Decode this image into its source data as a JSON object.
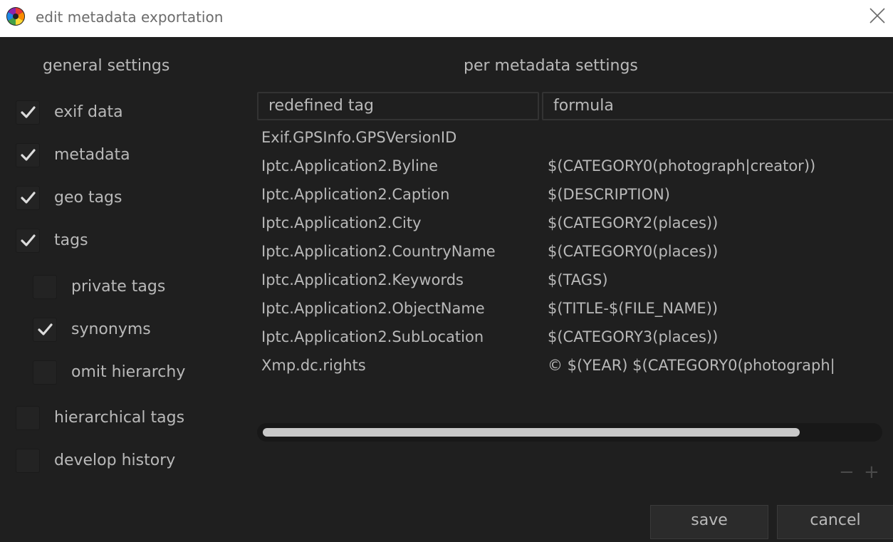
{
  "window": {
    "title": "edit metadata exportation",
    "icon": "darktable-logo-icon",
    "close_icon": "close-icon"
  },
  "general": {
    "header": "general settings",
    "items": [
      {
        "label": "exif data",
        "checked": true
      },
      {
        "label": "metadata",
        "checked": true
      },
      {
        "label": "geo tags",
        "checked": true
      },
      {
        "label": "tags",
        "checked": true
      },
      {
        "label": "private tags",
        "checked": false
      },
      {
        "label": "synonyms",
        "checked": true
      },
      {
        "label": "omit hierarchy",
        "checked": false
      },
      {
        "label": "hierarchical tags",
        "checked": false
      },
      {
        "label": "develop history",
        "checked": false
      }
    ]
  },
  "per_metadata": {
    "header": "per metadata settings",
    "columns": [
      "redefined tag",
      "formula"
    ],
    "rows": [
      {
        "tag": "Exif.GPSInfo.GPSVersionID",
        "formula": ""
      },
      {
        "tag": "Iptc.Application2.Byline",
        "formula": "$(CATEGORY0(photograph|creator))"
      },
      {
        "tag": "Iptc.Application2.Caption",
        "formula": "$(DESCRIPTION)"
      },
      {
        "tag": "Iptc.Application2.City",
        "formula": "$(CATEGORY2(places))"
      },
      {
        "tag": "Iptc.Application2.CountryName",
        "formula": "$(CATEGORY0(places))"
      },
      {
        "tag": "Iptc.Application2.Keywords",
        "formula": "$(TAGS)"
      },
      {
        "tag": "Iptc.Application2.ObjectName",
        "formula": "$(TITLE-$(FILE_NAME))"
      },
      {
        "tag": "Iptc.Application2.SubLocation",
        "formula": "$(CATEGORY3(places))"
      },
      {
        "tag": "Xmp.dc.rights",
        "formula": "© $(YEAR) $(CATEGORY0(photograph|"
      }
    ],
    "minus": "−",
    "plus": "+"
  },
  "buttons": {
    "save": "save",
    "cancel": "cancel"
  },
  "colors": {
    "background": "#1f1f1f",
    "text": "#b9b9b9",
    "titlebar": "#ffffff"
  }
}
